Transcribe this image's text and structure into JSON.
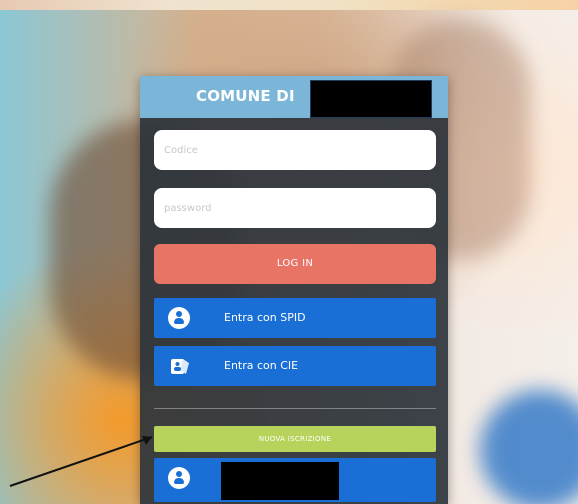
{
  "header": {
    "title": "COMUNE DI"
  },
  "login_form": {
    "code_placeholder": "Codice",
    "password_placeholder": "password",
    "login_label": "LOG IN"
  },
  "auth_buttons": {
    "spid_label": "Entra con SPID",
    "cie_label": "Entra con CIE"
  },
  "registration": {
    "label": "NUOVA ISCRIZIONE"
  },
  "colors": {
    "header_bg": "#7bb6d9",
    "login_button": "#e87466",
    "auth_button": "#1a6fd6",
    "registration_button": "#b8d35b",
    "panel_bg": "#2d343c"
  },
  "icons": {
    "spid": "user-circle-icon",
    "cie": "cie-card-icon",
    "bottom": "user-circle-icon"
  }
}
